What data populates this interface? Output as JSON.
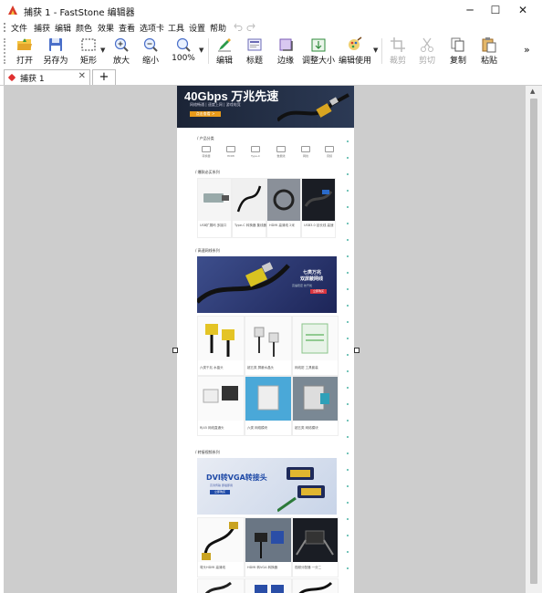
{
  "window": {
    "title": "捕获 1 - FastStone 编辑器",
    "controls": {
      "minimize": "─",
      "maximize": "☐",
      "close": "✕"
    }
  },
  "menu": {
    "items": [
      "文件",
      "捕获",
      "编辑",
      "颜色",
      "效果",
      "查看",
      "选项卡",
      "工具",
      "设置",
      "帮助"
    ],
    "undo_icon": "undo-icon",
    "redo_icon": "redo-icon"
  },
  "toolbar": {
    "open": "打开",
    "save_as": "另存为",
    "rect": "矩形",
    "zoom_in": "放大",
    "zoom_out": "缩小",
    "zoom_level": "100%",
    "edit": "编辑",
    "caption": "标题",
    "edge": "边缘",
    "resize": "调整大小",
    "edit_with": "编辑使用",
    "crop": "裁剪",
    "cut": "剪切",
    "copy": "复制",
    "paste": "粘贴",
    "more": "»"
  },
  "tabs": {
    "active_label": "捕获 1",
    "close": "✕",
    "add": "+"
  },
  "capture": {
    "banner_title": "40Gbps 万兆先速",
    "banner_sub": "网络畅通 | 速度上网 | 游戏电竞",
    "banner_button": "点击查看 >",
    "section_categories": "/ 产品分类",
    "categories": [
      "转换器",
      "HDMI",
      "Type-C",
      "数据线",
      "网线",
      "音频"
    ],
    "section_hot": "/ 爆款必买系列",
    "hot_items": [
      "USB扩展坞 多接口",
      "Type-C 转换器 集线器",
      "HDMI 高清线 2米",
      "USB3.0 延长线 高速"
    ],
    "section_network": "/ 高速网线系列",
    "network_banner_t1": "七类万兆",
    "network_banner_t2": "双屏蔽网线",
    "network_banner_sub": "高速稳定 抗干扰",
    "network_banner_btn": "立即购买",
    "network_items": [
      "六类千兆 水晶头",
      "超五类 屏蔽水晶头",
      "网线钳 工具套装",
      "RJ45 网线直通头",
      "六类 网络模块",
      "超五类 网络模块"
    ],
    "section_adapter": "/ 转接视频系列",
    "dvi_banner_title": "DVI转VGA转接头",
    "dvi_banner_sub": "高清传输 即插即用",
    "dvi_banner_btn": "立即购买",
    "adapter_items": [
      "弯头HDMI 高清线",
      "HDMI 转VGA 转换器",
      "视频分配器 一分二"
    ]
  },
  "colors": {
    "workspace": "#cdcdcd",
    "accent_teal": "#4ab3a4",
    "banner_dark": "#1b2436",
    "network_blue": "#3d4e8c",
    "dvi_blue": "#1f4aa7"
  }
}
